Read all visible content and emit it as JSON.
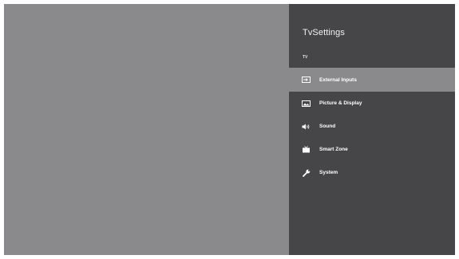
{
  "panel": {
    "title": "TvSettings",
    "section": "TV"
  },
  "menu": {
    "items": [
      {
        "label": "External Inputs",
        "icon": "input-icon",
        "selected": true
      },
      {
        "label": "Picture & Display",
        "icon": "picture-icon",
        "selected": false
      },
      {
        "label": "Sound",
        "icon": "speaker-icon",
        "selected": false
      },
      {
        "label": "Smart Zone",
        "icon": "tv-icon",
        "selected": false
      },
      {
        "label": "System",
        "icon": "wrench-icon",
        "selected": false
      }
    ]
  },
  "colors": {
    "background": "#8a8a8c",
    "panel": "#464649",
    "selected": "#8a8a8c",
    "text": "#ffffff"
  }
}
